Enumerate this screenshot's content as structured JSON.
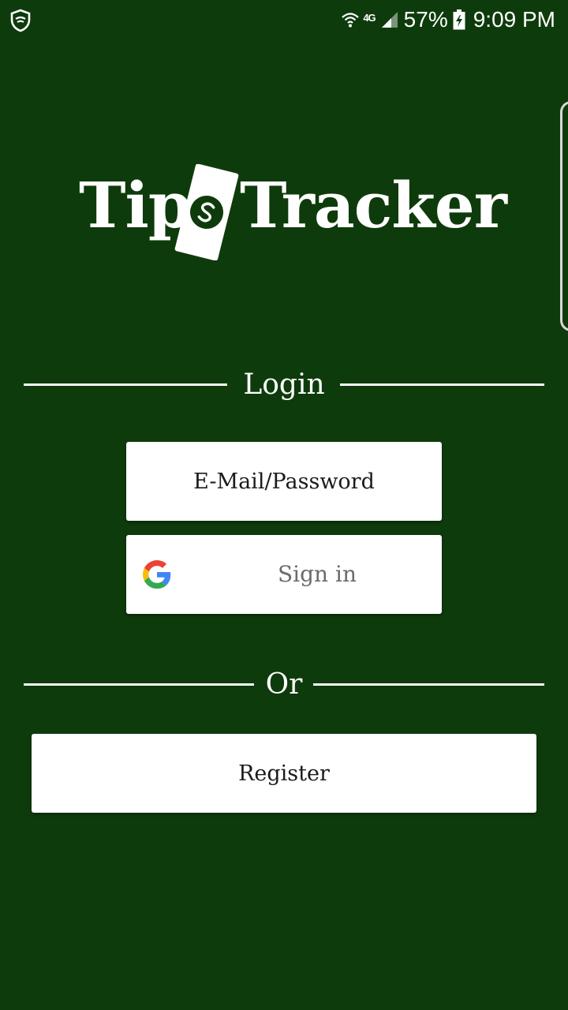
{
  "status_bar": {
    "network": "4G",
    "battery": "57%",
    "time": "9:09 PM"
  },
  "logo": {
    "word1": "Tip",
    "word2": "Tracker"
  },
  "login": {
    "heading": "Login",
    "email_button": "E-Mail/Password",
    "google_button": "Sign in"
  },
  "or": {
    "heading": "Or"
  },
  "register": {
    "button": "Register"
  },
  "colors": {
    "background": "#0e3b0b",
    "button": "#ffffff",
    "text_primary": "#1a1a1a",
    "text_muted": "#6b6b6b"
  }
}
